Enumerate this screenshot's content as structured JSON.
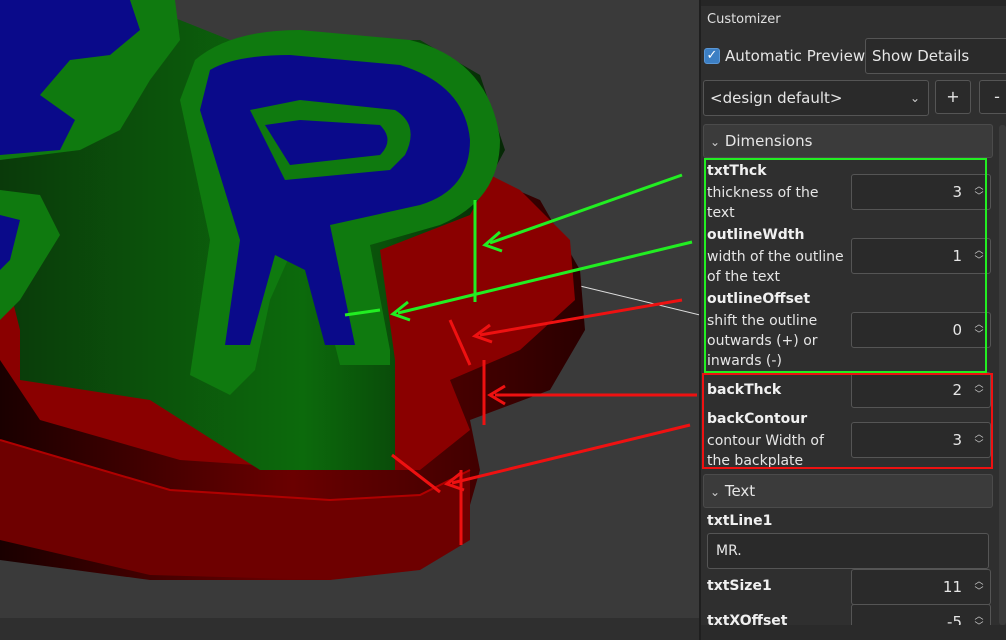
{
  "panel": {
    "title": "Customizer",
    "auto_preview_label": "Automatic Preview",
    "auto_preview_checked": true,
    "details_select": "Show Details",
    "preset_select": "<design default>",
    "add_label": "+",
    "remove_label": "-"
  },
  "sections": {
    "dimensions": "Dimensions",
    "text": "Text"
  },
  "params": {
    "txtThck": {
      "name": "txtThck",
      "desc": "thickness of the text",
      "value": "3"
    },
    "outlineWdth": {
      "name": "outlineWdth",
      "desc": "width of the outline of the text",
      "value": "1"
    },
    "outlineOffset": {
      "name": "outlineOffset",
      "desc": "shift the outline outwards (+) or inwards (-)",
      "value": "0"
    },
    "backThck": {
      "name": "backThck",
      "value": "2"
    },
    "backContour": {
      "name": "backContour",
      "desc": "contour Width of the backplate",
      "value": "3"
    },
    "txtLine1": {
      "name": "txtLine1",
      "value": "MR."
    },
    "txtSize1": {
      "name": "txtSize1",
      "value": "11"
    },
    "txtXOffset": {
      "name": "txtXOffset",
      "value": "-5"
    }
  },
  "colors": {
    "text_face": "#0a0a8a",
    "outline": "#0f7a0f",
    "backplate": "#8a0000",
    "annotation_green": "#22ee22",
    "annotation_red": "#ee1111"
  }
}
